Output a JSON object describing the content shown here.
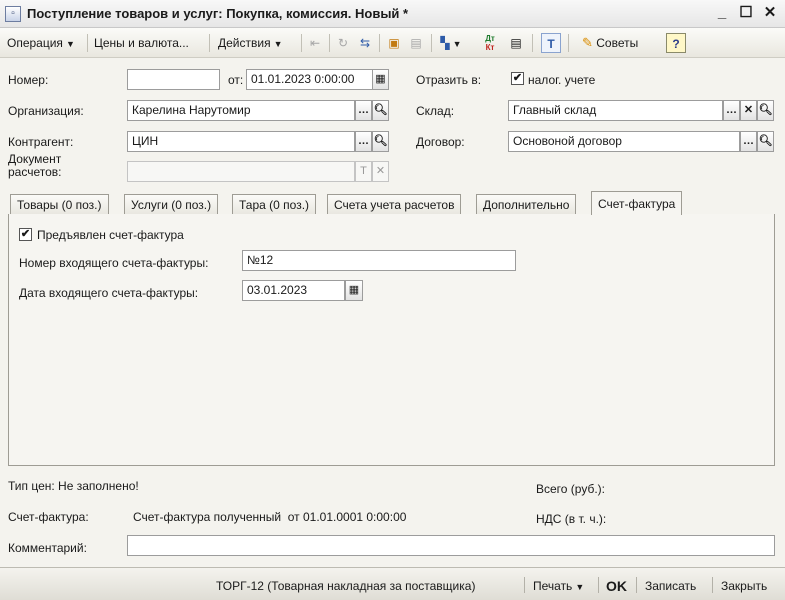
{
  "window": {
    "title": "Поступление товаров и услуг: Покупка, комиссия. Новый *",
    "controls": {
      "minimize": "_",
      "maximize": "☐",
      "close": "✕"
    }
  },
  "toolbar": {
    "operation": "Операция",
    "prices": "Цены и валюта...",
    "actions": "Действия",
    "advice": "Советы",
    "help": "?",
    "dtkt_top": "Дт",
    "dtkt_bottom": "Кт",
    "icons": [
      "go-back-icon",
      "refresh-icon",
      "post-icon",
      "structure-icon",
      "based-on-icon",
      "create-based-icon",
      "dt-kt-icon",
      "journal-icon",
      "text-format-icon",
      "advice-icon",
      "help-icon"
    ]
  },
  "header": {
    "number_label": "Номер:",
    "number_value": "",
    "from_label": "от:",
    "date_value": "01.01.2023 0:00:00",
    "reflect_label": "Отразить в:",
    "tax_checked": true,
    "tax_label": "налог. учете",
    "org_label": "Организация:",
    "org_value": "Карелина Нарутомир",
    "warehouse_label": "Склад:",
    "warehouse_value": "Главный склад",
    "counterparty_label": "Контрагент:",
    "counterparty_value": "ЦИН",
    "contract_label": "Договор:",
    "contract_value": "Основоной договор",
    "settlement_label_1": "Документ",
    "settlement_label_2": "расчетов:",
    "settlement_value": ""
  },
  "tabs": [
    {
      "label": "Товары (0 поз.)",
      "active": false
    },
    {
      "label": "Услуги (0 поз.)",
      "active": false
    },
    {
      "label": "Тара (0 поз.)",
      "active": false
    },
    {
      "label": "Счета учета расчетов",
      "active": false
    },
    {
      "label": "Дополнительно",
      "active": false
    },
    {
      "label": "Счет-фактура",
      "active": true
    }
  ],
  "invoice": {
    "presented_checked": true,
    "presented_label": "Предъявлен счет-фактура",
    "number_label": "Номер входящего счета-фактуры:",
    "number_value": "№12",
    "date_label": "Дата входящего счета-фактуры:",
    "date_value": "03.01.2023"
  },
  "footer": {
    "price_type": "Тип цен: Не заполнено!",
    "total_label": "Всего (руб.):",
    "invoice_label": "Счет-фактура:",
    "invoice_value": "Счет-фактура полученный  от 01.01.0001 0:00:00",
    "vat_label": "НДС (в т. ч.):",
    "comment_label": "Комментарий:",
    "comment_value": ""
  },
  "statusbar": {
    "torg": "ТОРГ-12 (Товарная накладная за поставщика)",
    "print": "Печать",
    "ok": "OK",
    "save": "Записать",
    "close": "Закрыть"
  },
  "colors": {
    "accent": "#3c5a99",
    "check": "#1a1a1a",
    "field_border": "#9c9c9c",
    "window_bg": "#f4f3ee"
  }
}
